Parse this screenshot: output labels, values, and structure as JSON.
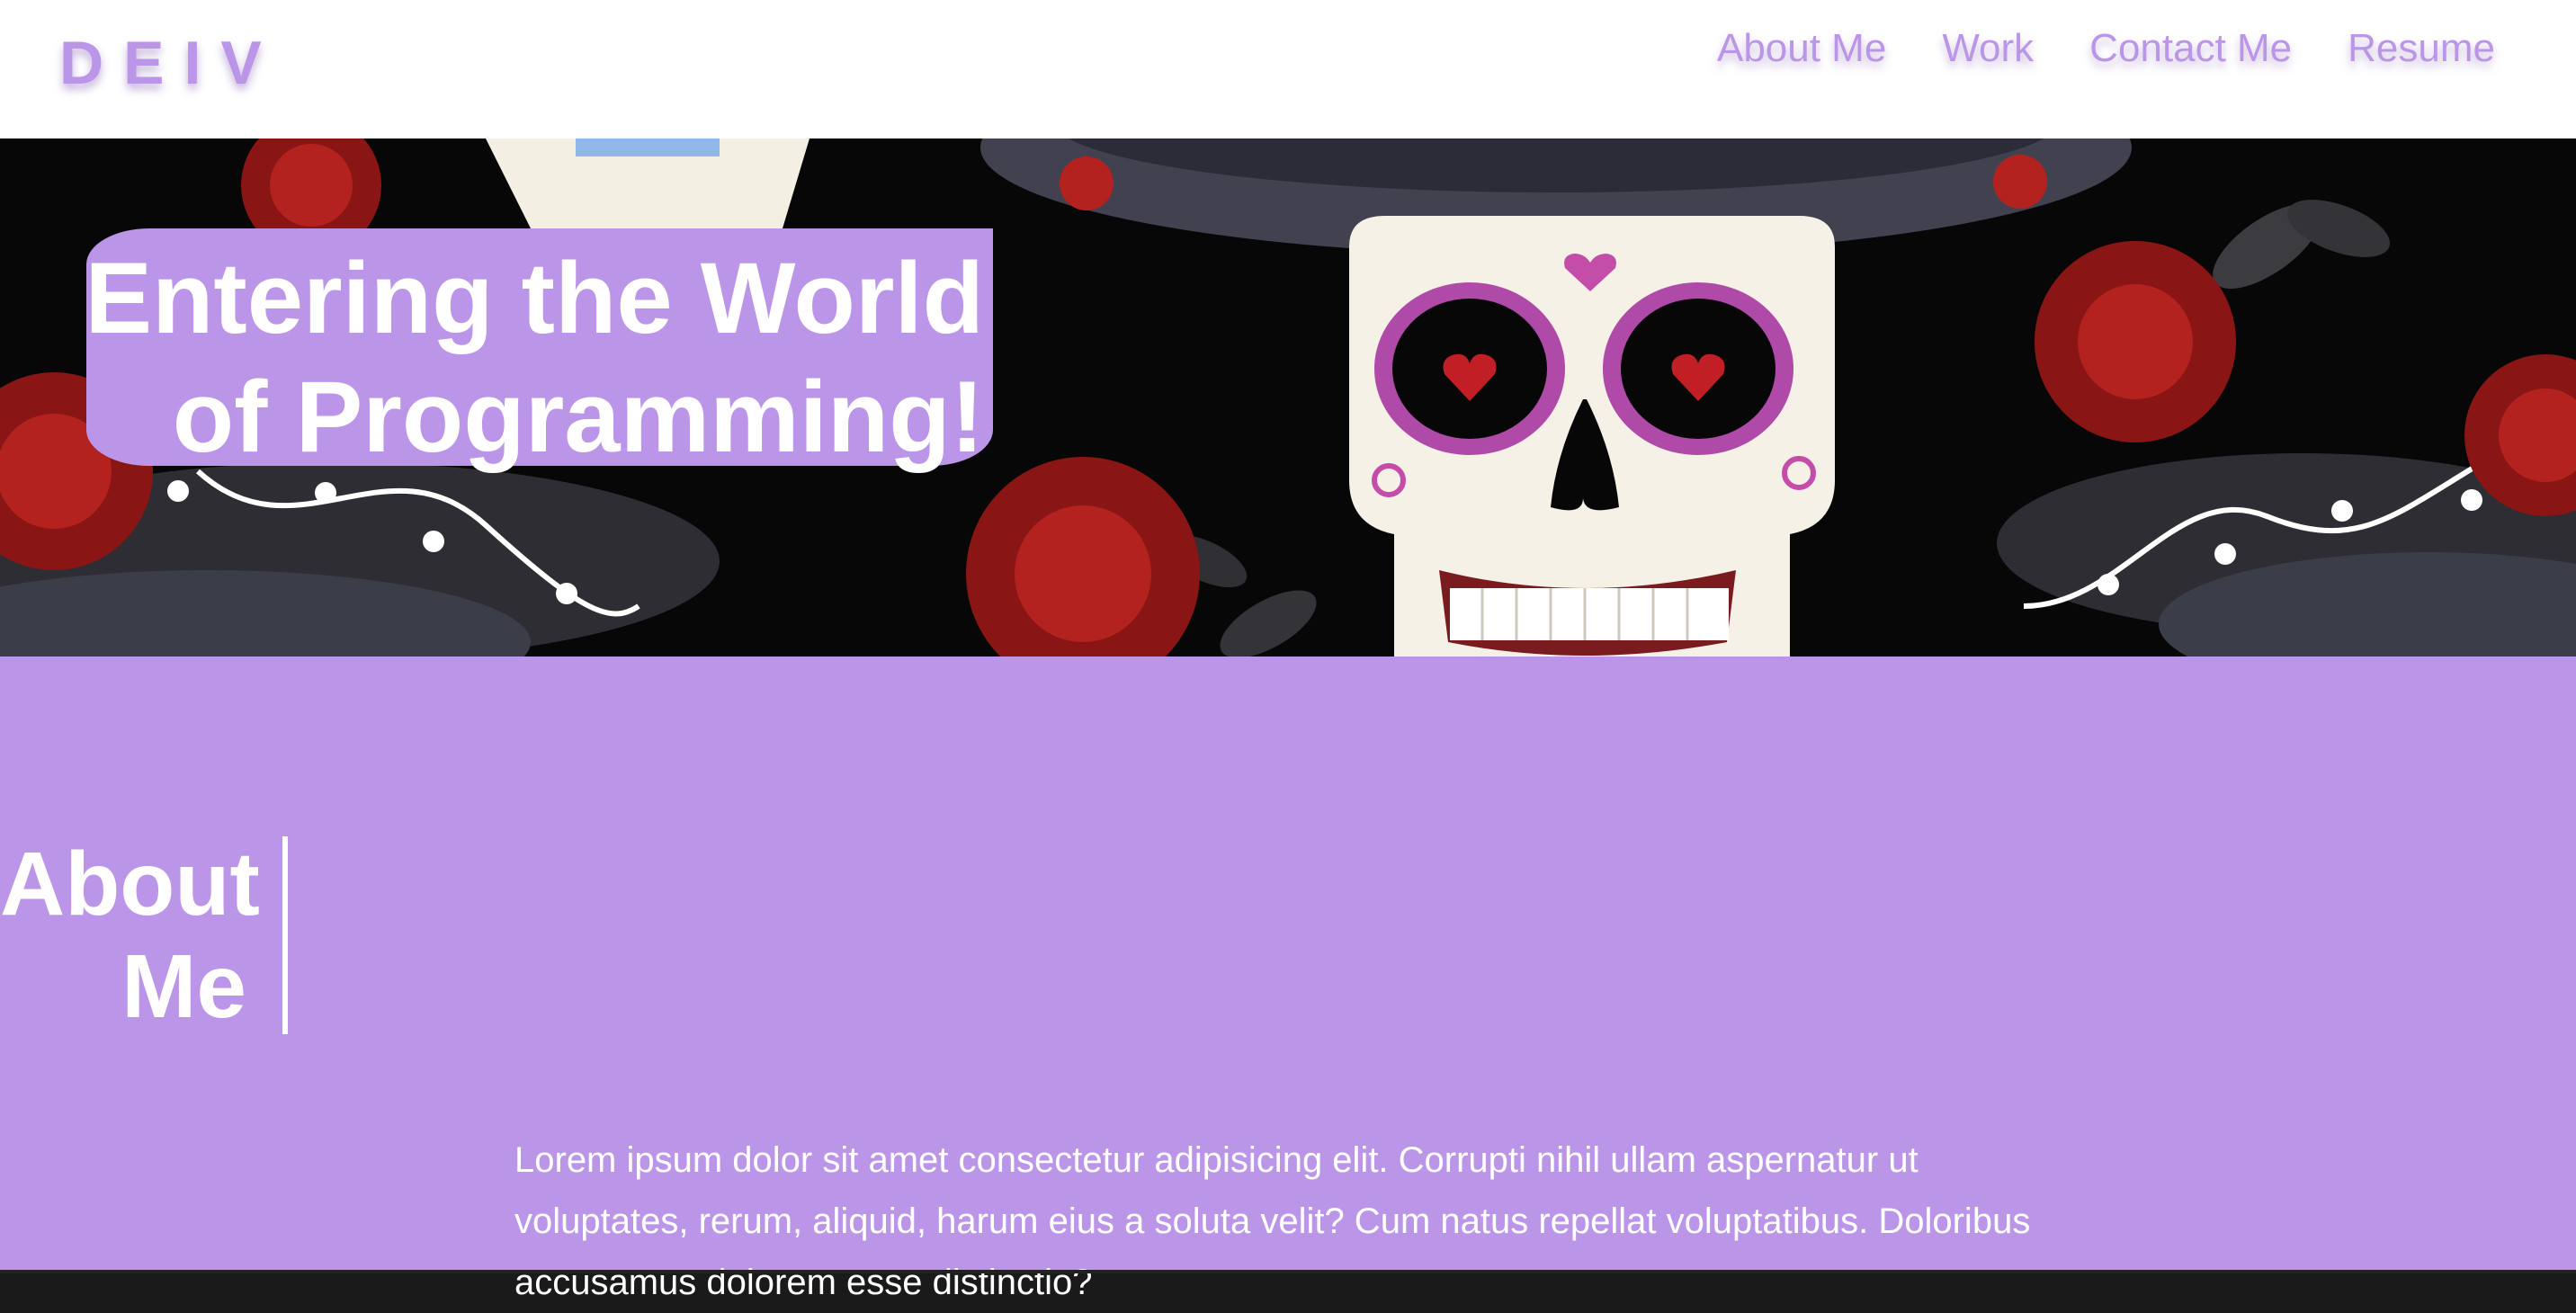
{
  "header": {
    "logo": "DEIV",
    "nav": [
      "About Me",
      "Work",
      "Contact Me",
      "Resume"
    ]
  },
  "hero": {
    "title_line1": "Entering the World",
    "title_line2": "of Programming!",
    "image": "sugar skull with roses on black background"
  },
  "about": {
    "heading_line1": "About",
    "heading_line2": "Me",
    "paragraph": "Lorem ipsum dolor sit amet consectetur adipisicing elit. Corrupti nihil ullam aspernatur ut voluptates, rerum, aliquid, harum eius a soluta velit? Cum natus repellat voluptatibus. Doloribus accusamus dolorem esse distinctio?"
  },
  "colors": {
    "accent": "#bb96e8",
    "hero_background": "#070707",
    "text_light": "#ffffff"
  }
}
